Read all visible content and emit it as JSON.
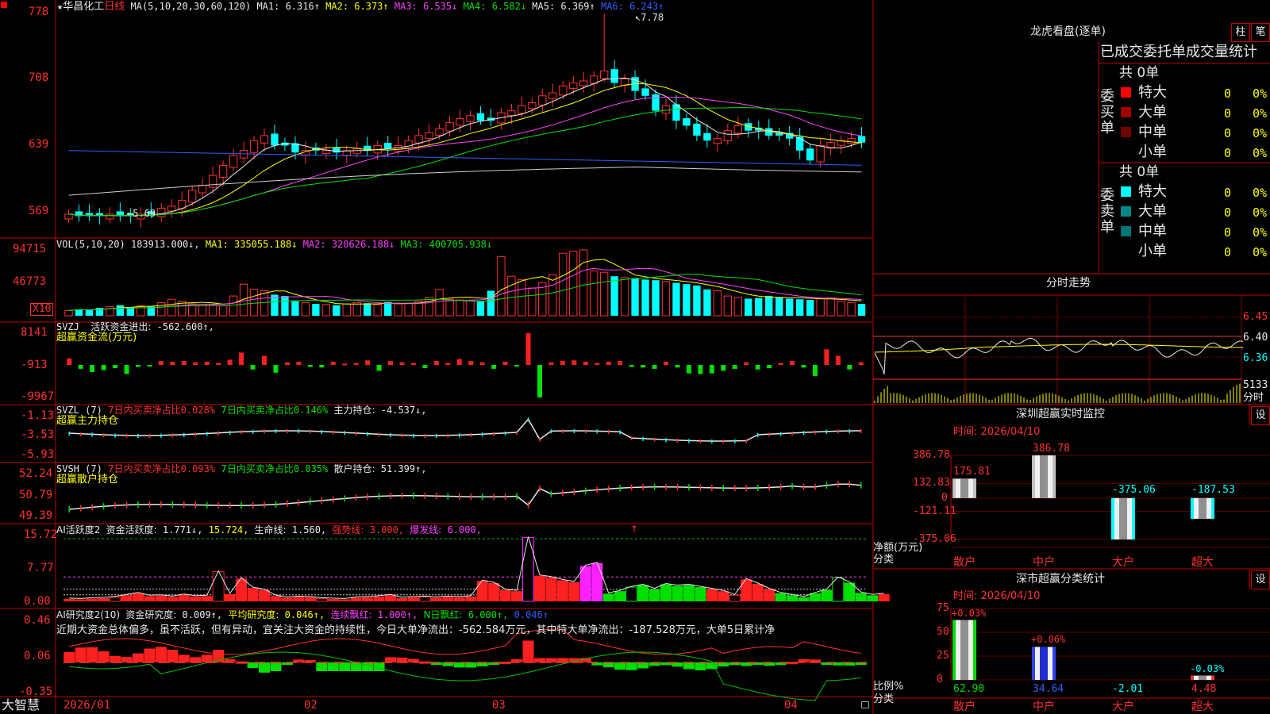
{
  "header": {
    "stock_name": "华昌化工",
    "period": "日线",
    "ma_def": "MA(5,10,20,30,60,120)",
    "ma": [
      {
        "label": "MA1:",
        "value": "6.316↑",
        "color": "#e8e8e8"
      },
      {
        "label": "MA2:",
        "value": "6.373↑",
        "color": "#ffff00"
      },
      {
        "label": "MA3:",
        "value": "6.535↓",
        "color": "#ff40ff"
      },
      {
        "label": "MA4:",
        "value": "6.582↓",
        "color": "#00e000"
      },
      {
        "label": "MA5:",
        "value": "6.369↑",
        "color": "#e8e8e8"
      },
      {
        "label": "MA6:",
        "value": "6.243↑",
        "color": "#3060ff"
      }
    ]
  },
  "price_panel": {
    "y_labels": [
      "778",
      "708",
      "639",
      "569"
    ],
    "high_marker": "7.78",
    "low_marker": "5.69"
  },
  "vol_panel": {
    "title": "VOL(5,10,20)",
    "value": "183913.000↓",
    "ma": [
      {
        "label": "MA1:",
        "value": "335055.188↓",
        "color": "#ffff00"
      },
      {
        "label": "MA2:",
        "value": "320626.188↓",
        "color": "#ff40ff"
      },
      {
        "label": "MA3:",
        "value": "400705.938↓",
        "color": "#00e000"
      }
    ],
    "y_labels": [
      "94715",
      "46773"
    ],
    "unit": "X10"
  },
  "svzj_panel": {
    "title": "SVZJ",
    "desc": "活跃资金进出:",
    "value": "-562.600↑,",
    "sub": "超赢资金流(万元)",
    "y_labels": [
      "8141",
      "-913",
      "-9967"
    ]
  },
  "svzl_panel": {
    "title": "SVZL (7)",
    "t1": "7日内买卖净占比",
    "v1": "0.028%",
    "t2": "7日内买卖净占比",
    "v2": "0.146%",
    "t3": "主力持仓:",
    "v3": "-4.537↓,",
    "sub": "超赢主力持仓",
    "y_labels": [
      "-1.13",
      "-3.53",
      "-5.93"
    ]
  },
  "svsh_panel": {
    "title": "SVSH (7)",
    "t1": "7日内买卖净占比",
    "v1": "0.093%",
    "t2": "7日内买卖净占比",
    "v2": "0.035%",
    "t3": "散户持仓:",
    "v3": "51.399↑,",
    "sub": "超赢散户持仓",
    "y_labels": [
      "52.24",
      "50.79",
      "49.39"
    ]
  },
  "ai_active_panel": {
    "title": "AI活跃度2",
    "t1": "资金活跃度:",
    "v1": "1.771↓,",
    "v2": "15.724,",
    "t3": "生命线:",
    "v3": "1.560,",
    "t4": "强势线:",
    "v4": "3.000,",
    "t5": "爆发线:",
    "v5": "6.000,",
    "y_labels": [
      "15.72",
      "7.77",
      "0.00"
    ]
  },
  "ai_research_panel": {
    "title": "AI研究度2(10)",
    "t1": "资金研究度:",
    "v1": "0.009↑,",
    "t2": "平均研究度:",
    "v2": "0.046↑,",
    "t3": "连续飘红:",
    "v3": "1.000↑,",
    "t4": "N日飘红:",
    "v4": "6.000↑,",
    "v5": "0.046↑",
    "commentary": "近期大资金总体偏多，虽不活跃，但有异动，宜关注大资金的持续性，今日大单净流出：-562.584万元，其中特大单净流出：-187.528万元，大单5日累计净",
    "y_labels": [
      "0.46",
      "0.06",
      "-0.35"
    ]
  },
  "date_axis": {
    "brand": "大智慧",
    "labels": [
      "2026/01",
      "02",
      "03",
      "04"
    ]
  },
  "dragon_panel": {
    "title": "龙虎看盘(逐单)",
    "btn_bar": "柱",
    "btn_pen": "笔",
    "tabs": "已成交委托单成交量统计",
    "buy": {
      "side": "委买单",
      "total": "共 0单",
      "rows": [
        {
          "name": "特大",
          "count": "0",
          "pct": "0%",
          "color": "#ff0000"
        },
        {
          "name": "大单",
          "count": "0",
          "pct": "0%",
          "color": "#a00000"
        },
        {
          "name": "中单",
          "count": "0",
          "pct": "0%",
          "color": "#700000"
        },
        {
          "name": "小单",
          "count": "0",
          "pct": "0%",
          "color": "#000000"
        }
      ]
    },
    "sell": {
      "side": "委卖单",
      "total": "共 0单",
      "rows": [
        {
          "name": "特大",
          "count": "0",
          "pct": "0%",
          "color": "#00ffff"
        },
        {
          "name": "大单",
          "count": "0",
          "pct": "0%",
          "color": "#008888"
        },
        {
          "name": "中单",
          "count": "0",
          "pct": "0%",
          "color": "#007777"
        },
        {
          "name": "小单",
          "count": "0",
          "pct": "0%",
          "color": "#000000"
        }
      ]
    }
  },
  "intraday_panel": {
    "title": "分时走势",
    "y_labels": [
      "6.45",
      "6.40",
      "6.36"
    ],
    "vol_label": "5133",
    "vol_unit": "分时"
  },
  "sz_monitor": {
    "title": "深圳超赢实时监控",
    "set": "设",
    "time": "时间: 2026/04/10",
    "y_labels": [
      "386.78",
      "132.83",
      "0",
      "-121.11",
      "-375.06"
    ],
    "unit": "净额(万元)",
    "cat_label": "分类",
    "categories": [
      "散户",
      "中户",
      "大户",
      "超大"
    ],
    "values": [
      "175.81",
      "386.78",
      "-375.06",
      "-187.53"
    ]
  },
  "sz_class": {
    "title": "深市超赢分类统计",
    "set": "设",
    "time": "时间: 2026/04/10",
    "y_labels": [
      "75",
      "50",
      "25",
      "0"
    ],
    "unit": "比例%",
    "cat_label": "分类",
    "categories": [
      "散户",
      "中户",
      "大户",
      "超大"
    ],
    "top_labels": [
      "+0.03%",
      "+0.06%",
      "",
      "-0.03%"
    ],
    "bottom_values": [
      "62.90",
      "34.64",
      "-2.01",
      "4.48"
    ]
  },
  "chart_data": {
    "type": "candlestick",
    "closes": [
      5.76,
      5.74,
      5.74,
      5.74,
      5.76,
      5.74,
      5.74,
      5.76,
      5.76,
      5.82,
      5.84,
      5.9,
      6.0,
      6.05,
      6.15,
      6.25,
      6.35,
      6.4,
      6.5,
      6.55,
      6.45,
      6.45,
      6.38,
      6.4,
      6.4,
      6.4,
      6.38,
      6.4,
      6.42,
      6.4,
      6.45,
      6.42,
      6.45,
      6.5,
      6.55,
      6.58,
      6.62,
      6.68,
      6.72,
      6.75,
      6.7,
      6.7,
      6.78,
      6.8,
      6.85,
      6.88,
      6.95,
      6.98,
      7.05,
      7.08,
      7.1,
      7.15,
      7.2,
      7.08,
      7.12,
      7.0,
      6.95,
      6.8,
      6.85,
      6.7,
      6.65,
      6.55,
      6.5,
      6.52,
      6.6,
      6.65,
      6.6,
      6.6,
      6.55,
      6.55,
      6.52,
      6.4,
      6.3,
      6.45,
      6.48,
      6.5,
      6.52,
      6.48
    ],
    "up_days": [
      1,
      0,
      0,
      0,
      1,
      0,
      0,
      1,
      0,
      1,
      1,
      1,
      1,
      1,
      1,
      1,
      1,
      1,
      1,
      1,
      0,
      0,
      0,
      1,
      0,
      1,
      0,
      1,
      1,
      0,
      1,
      0,
      1,
      1,
      1,
      1,
      1,
      1,
      1,
      1,
      0,
      0,
      1,
      1,
      1,
      1,
      1,
      1,
      1,
      1,
      1,
      1,
      1,
      0,
      1,
      0,
      0,
      0,
      1,
      0,
      0,
      0,
      0,
      1,
      1,
      1,
      0,
      0,
      0,
      0,
      0,
      0,
      0,
      1,
      1,
      1,
      1,
      0
    ],
    "volumes": [
      8,
      10,
      9,
      12,
      14,
      16,
      13,
      15,
      14,
      20,
      25,
      22,
      18,
      17,
      16,
      15,
      30,
      48,
      40,
      38,
      32,
      30,
      22,
      20,
      18,
      17,
      16,
      18,
      20,
      19,
      17,
      21,
      18,
      19,
      22,
      28,
      40,
      25,
      24,
      23,
      22,
      38,
      90,
      60,
      55,
      42,
      50,
      62,
      95,
      98,
      100,
      68,
      66,
      60,
      58,
      57,
      55,
      54,
      52,
      50,
      48,
      46,
      40,
      38,
      30,
      28,
      26,
      27,
      30,
      28,
      26,
      25,
      24,
      26,
      27,
      22,
      20,
      18
    ],
    "svzj": [
      1,
      -0.6,
      -1.1,
      -0.8,
      -0.5,
      -1.4,
      -0.3,
      -0.2,
      0.6,
      0.5,
      0.6,
      0.4,
      0.5,
      0.3,
      0.8,
      1.9,
      -0.7,
      1.4,
      -1.2,
      0.4,
      0.5,
      -0.3,
      -0.4,
      0.5,
      0.2,
      0.3,
      0.7,
      -0.9,
      0.6,
      0.4,
      0.3,
      -0.5,
      0.6,
      0.3,
      0.9,
      0.6,
      0.4,
      -0.6,
      0.5,
      -0.2,
      4.9,
      -5.0,
      0.4,
      0.6,
      0.7,
      0.5,
      0.3,
      0.5,
      0.6,
      -0.3,
      -0.4,
      -0.6,
      0.5,
      -0.4,
      -1.3,
      -1.4,
      -1.3,
      -0.9,
      -0.6,
      0.4,
      -0.7,
      -0.5,
      0.3,
      0.6,
      -0.4,
      -1.7,
      2.4,
      1.4,
      -0.7,
      0.4
    ],
    "ai_active": [
      0.6,
      0.5,
      0.7,
      0.8,
      1.0,
      1.5,
      2.0,
      1.3,
      1.4,
      1.1,
      1.6,
      1.2,
      1.3,
      7.3,
      1.8,
      5.6,
      3.3,
      2.8,
      1.3,
      0.9,
      1.1,
      1.0,
      0.7,
      0.6,
      0.5,
      0.9,
      1.0,
      1.2,
      1.5,
      0.8,
      1.0,
      1.1,
      0.9,
      1.1,
      1.0,
      1.2,
      5.0,
      4.5,
      2.8,
      2.5,
      15.7,
      6.3,
      5.9,
      5.2,
      4.7,
      8.7,
      9.4,
      1.9,
      2.5,
      3.5,
      4.0,
      3.0,
      4.2,
      3.8,
      4.0,
      3.5,
      3.0,
      2.5,
      1.5,
      5.4,
      4.3,
      3.0,
      2.0,
      1.5,
      1.0,
      2.0,
      2.8,
      5.8,
      4.6,
      2.1,
      1.5,
      1.8
    ]
  }
}
